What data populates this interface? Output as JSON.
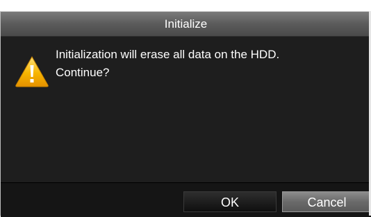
{
  "dialog": {
    "title": "Initialize",
    "icon": "warning-icon",
    "message_line1": "Initialization will erase all data on the HDD.",
    "message_line2": "Continue?"
  },
  "buttons": {
    "ok_label": "OK",
    "cancel_label": "Cancel"
  },
  "colors": {
    "warning": "#f5b400",
    "titlebar": "#5b5b5b",
    "body": "#1e1e1e"
  }
}
